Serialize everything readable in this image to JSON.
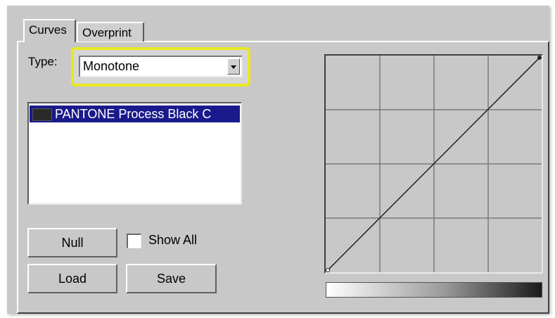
{
  "tabs": [
    {
      "label": "Curves",
      "active": true
    },
    {
      "label": "Overprint",
      "active": false
    }
  ],
  "type_field": {
    "label": "Type:",
    "value": "Monotone",
    "highlight_color": "#e8e820"
  },
  "inks_list": {
    "items": [
      {
        "label": "PANTONE Process Black C",
        "selected": true,
        "swatch_color": "#2a2a2a"
      }
    ]
  },
  "buttons": {
    "null_label": "Null",
    "load_label": "Load",
    "save_label": "Save"
  },
  "show_all": {
    "label": "Show All",
    "checked": false
  },
  "curve": {
    "grid_divisions": 4,
    "points": [
      [
        0,
        0
      ],
      [
        100,
        100
      ]
    ]
  },
  "colors": {
    "dialog_bg": "#c8c8c8",
    "selection_bg": "#1a1a8c",
    "selection_text": "#ffffff"
  }
}
